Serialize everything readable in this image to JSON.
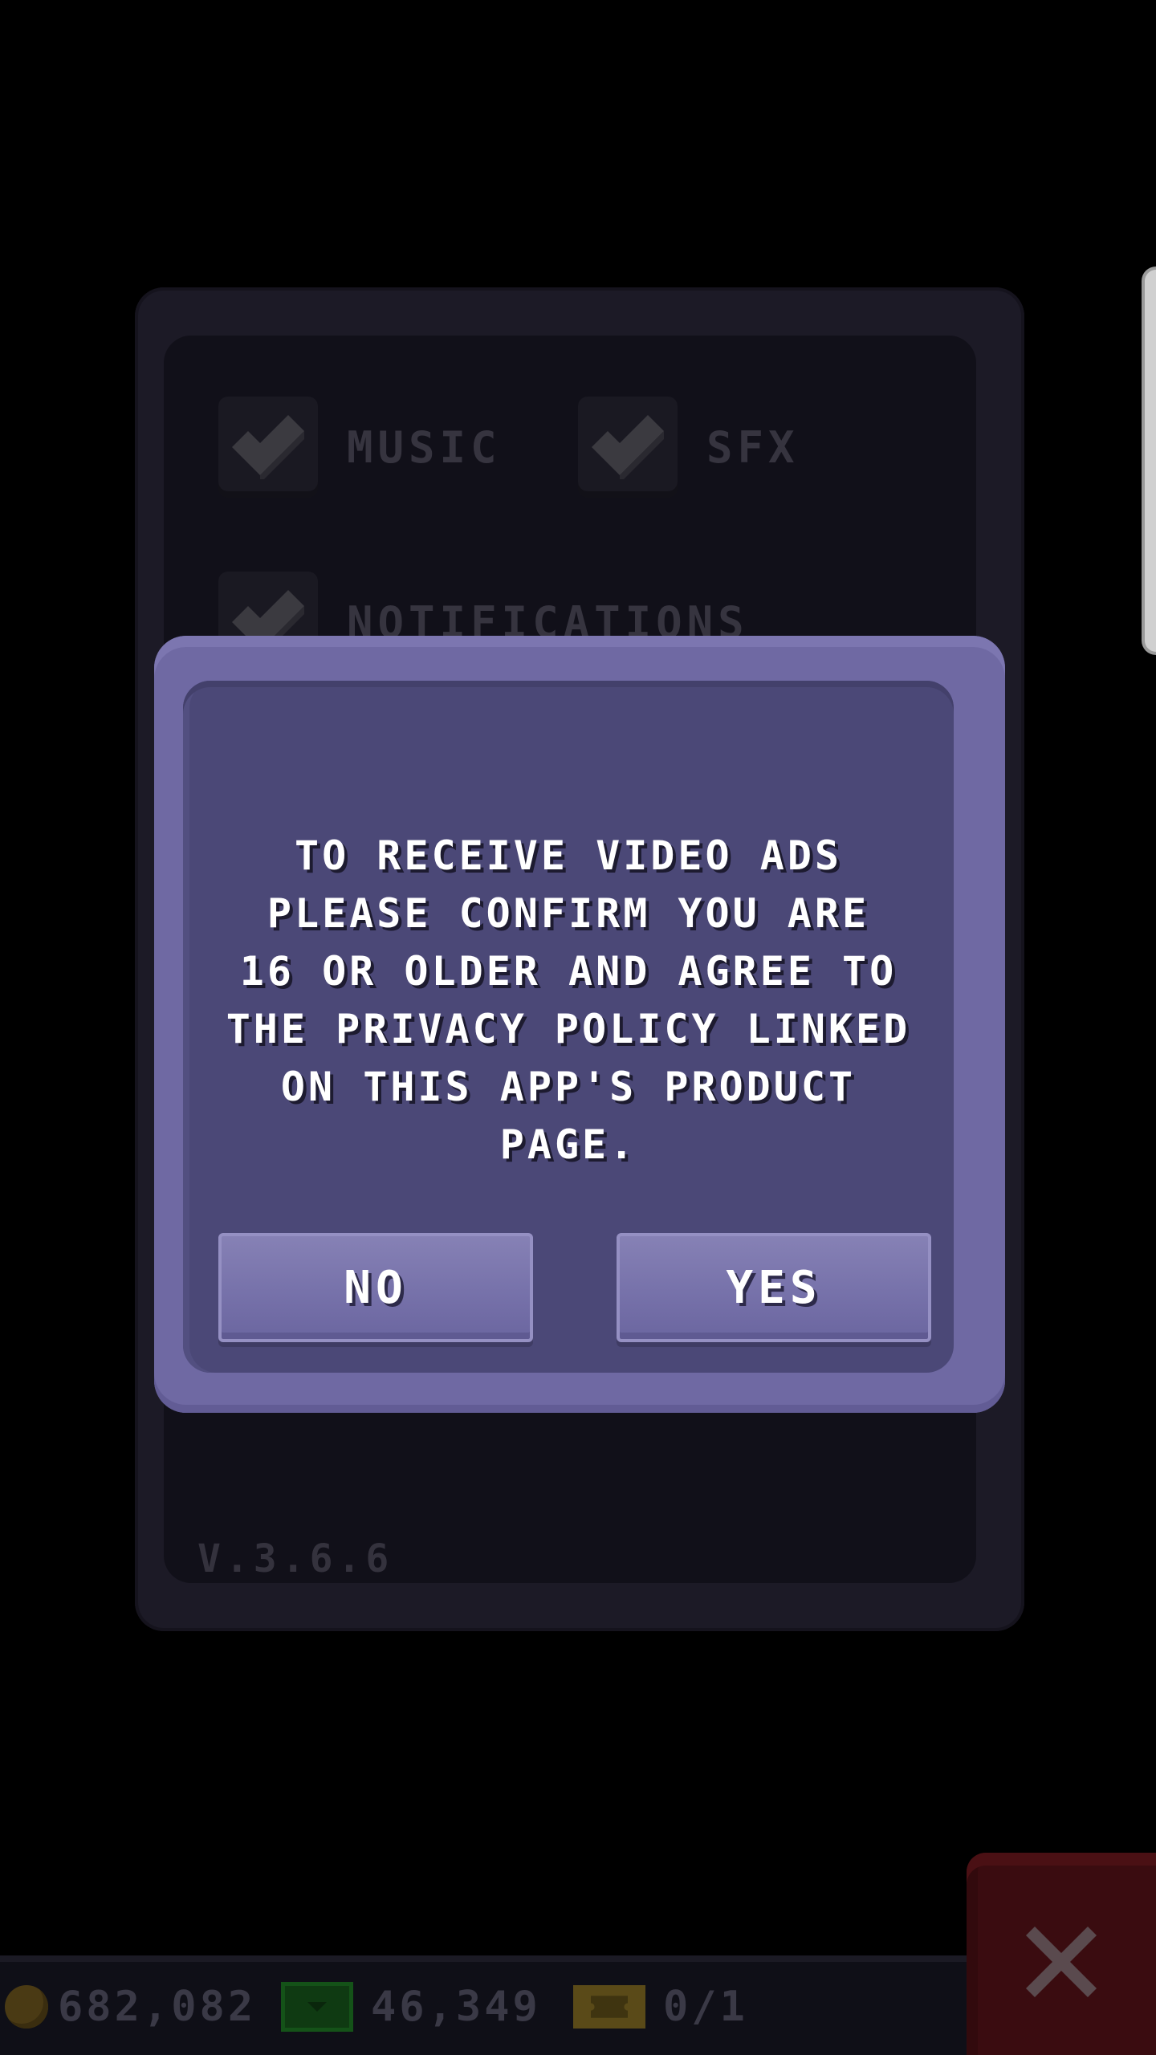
{
  "settings": {
    "options": [
      {
        "label": "MUSIC",
        "checked": true
      },
      {
        "label": "SFX",
        "checked": true
      },
      {
        "label": "NOTIFICATIONS",
        "checked": true
      }
    ],
    "version": "V.3.6.6"
  },
  "dialog": {
    "message": "TO RECEIVE VIDEO ADS\nPLEASE CONFIRM YOU ARE\n16 OR OLDER AND AGREE TO\nTHE PRIVACY POLICY LINKED\nON THIS APP'S PRODUCT\nPAGE.",
    "no_label": "NO",
    "yes_label": "YES"
  },
  "resources": {
    "coins": "682,082",
    "cash": "46,349",
    "tickets": "0/1"
  },
  "icons": {
    "checkmark": "checkmark-icon",
    "coin": "coin-icon",
    "cash": "cash-icon",
    "ticket": "ticket-icon",
    "close": "close-icon"
  },
  "colors": {
    "dialog_frame": "#6f69a3",
    "dialog_body": "#4b4877",
    "button": "#7873ab",
    "close_button": "#3a0c10",
    "text": "#ffffff"
  }
}
